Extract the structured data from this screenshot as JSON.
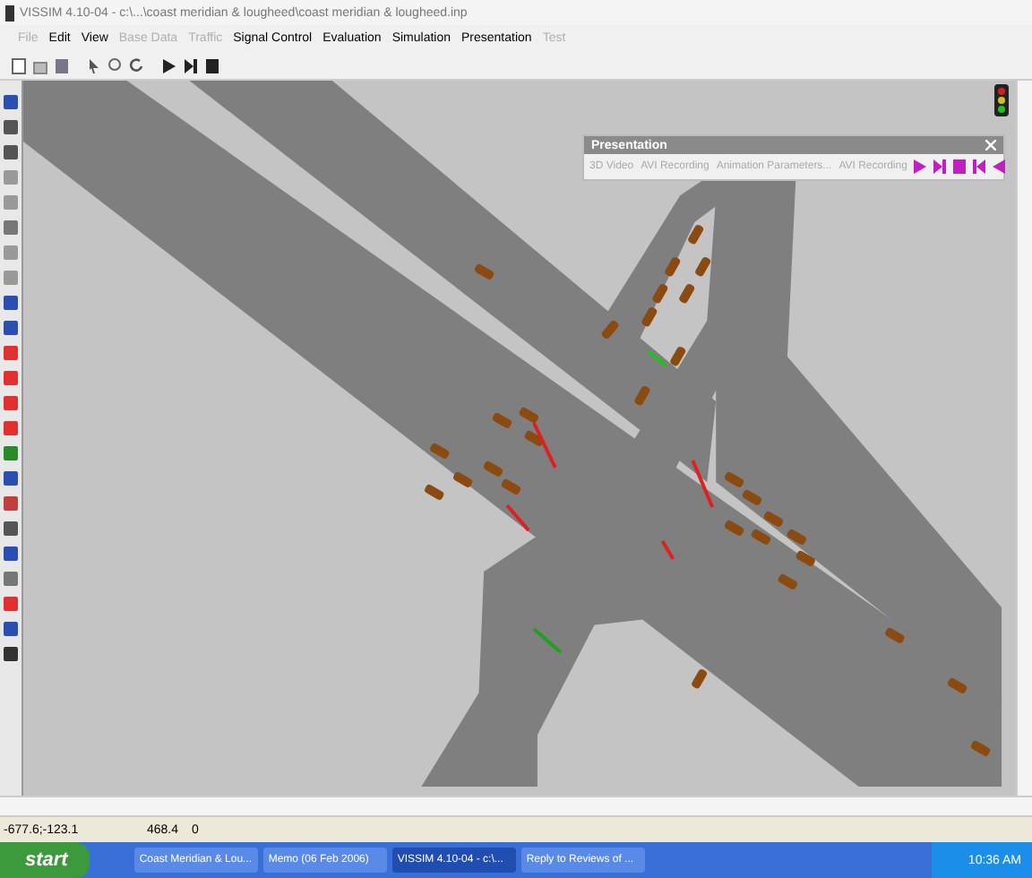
{
  "window": {
    "title": "VISSIM 4.10-04 - c:\\...\\coast meridian & lougheed\\coast meridian & lougheed.inp"
  },
  "menu": [
    {
      "label": "File",
      "disabled": true
    },
    {
      "label": "Edit",
      "disabled": false
    },
    {
      "label": "View",
      "disabled": false
    },
    {
      "label": "Base Data",
      "disabled": true
    },
    {
      "label": "Traffic",
      "disabled": true
    },
    {
      "label": "Signal Control",
      "disabled": false
    },
    {
      "label": "Evaluation",
      "disabled": false
    },
    {
      "label": "Simulation",
      "disabled": false
    },
    {
      "label": "Presentation",
      "disabled": false
    },
    {
      "label": "Test",
      "disabled": true
    }
  ],
  "presentation": {
    "title": "Presentation",
    "buttons": [
      {
        "label": "3D Video",
        "disabled": true
      },
      {
        "label": "AVI Recording",
        "disabled": true
      },
      {
        "label": "Animation Parameters...",
        "disabled": true
      },
      {
        "label": "AVI Recording",
        "disabled": true
      }
    ]
  },
  "status_bar": [
    "-677.6;-123.1",
    "468.4",
    "0"
  ],
  "taskbar": {
    "start": "start",
    "tasks": [
      {
        "label": "Coast Meridian & Lou...",
        "selected": false
      },
      {
        "label": "Memo (06 Feb 2006)",
        "selected": false
      },
      {
        "label": "VISSIM 4.10-04 - c:\\...",
        "selected": true
      },
      {
        "label": "Reply to Reviews of ...",
        "selected": false
      }
    ],
    "clock": "10:36 AM"
  }
}
